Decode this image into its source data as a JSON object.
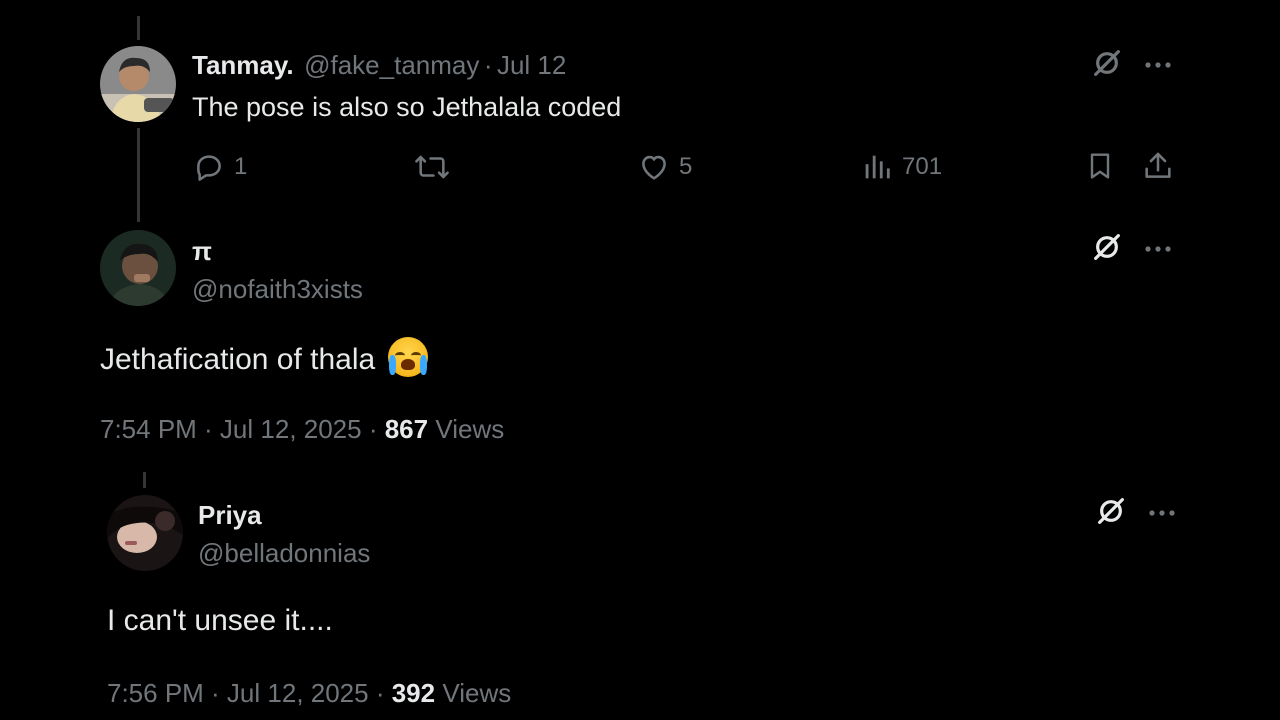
{
  "reply1": {
    "name": "Tanmay.",
    "handle": "@fake_tanmay",
    "separator": "·",
    "date": "Jul 12",
    "text": "The pose is also so Jethalala coded",
    "stats": {
      "replies": "1",
      "likes": "5",
      "views": "701"
    }
  },
  "main_post": {
    "name": "π",
    "handle": "@nofaith3xists",
    "text": "Jethafication of thala",
    "emoji_name": "loudly-crying-face",
    "timestamp": "7:54 PM · Jul 12, 2025 · ",
    "views_count": "867",
    "views_label": "Views"
  },
  "reply2": {
    "name": "Priya",
    "handle": "@belladonnias",
    "text": "I can't unsee it....",
    "timestamp": "7:56 PM · Jul 12, 2025 · ",
    "views_count": "392",
    "views_label": "Views"
  },
  "icons": {
    "grok": "grok-icon",
    "more": "more-icon",
    "reply": "reply-icon",
    "repost": "repost-icon",
    "like": "like-icon",
    "views": "views-icon",
    "bookmark": "bookmark-icon",
    "share": "share-icon"
  },
  "colors": {
    "background": "#000000",
    "text": "#e7e9ea",
    "muted": "#71767b",
    "thread_line": "#333639"
  }
}
